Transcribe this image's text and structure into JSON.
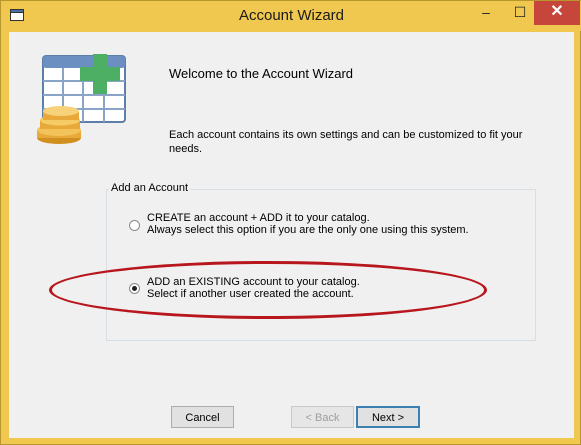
{
  "window": {
    "title": "Account Wizard"
  },
  "titlebar": {
    "minimize": "–",
    "maximize": "☐",
    "close": "✕"
  },
  "wizard": {
    "heading": "Welcome to the Account Wizard",
    "description": "Each account contains its own settings and can be customized to fit your needs."
  },
  "group": {
    "label": "Add an Account",
    "options": [
      {
        "line1": "CREATE an account + ADD it to your catalog.",
        "line2": "Always select this option if you are the only one using this system.",
        "selected": false
      },
      {
        "line1": "ADD an EXISTING account to your catalog.",
        "line2": "Select if another user created the account.",
        "selected": true
      }
    ]
  },
  "buttons": {
    "cancel": "Cancel",
    "back": "< Back",
    "next": "Next >"
  },
  "colors": {
    "highlight_ellipse": "#b8161d",
    "title_bar": "#f0c850",
    "close_button": "#c7463c"
  }
}
